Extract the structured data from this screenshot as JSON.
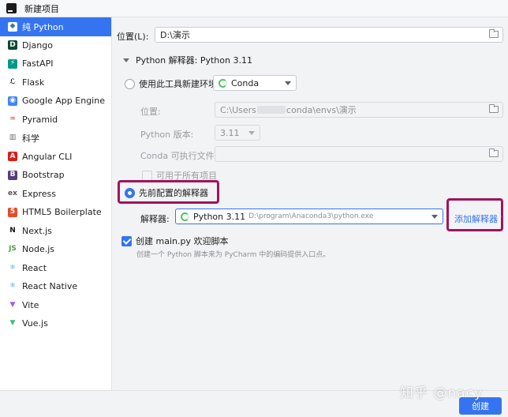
{
  "window": {
    "title": "新建项目"
  },
  "sidebar": {
    "items": [
      {
        "label": "纯 Python",
        "icon": "python-icon",
        "glyph": "◆",
        "bg": "#ffffff",
        "fg": "#3776ab"
      },
      {
        "label": "Django",
        "icon": "django-icon",
        "glyph": "D",
        "bg": "#0c4b33",
        "fg": "#ffffff"
      },
      {
        "label": "FastAPI",
        "icon": "fastapi-icon",
        "glyph": "⚡",
        "bg": "#05998b",
        "fg": "#ffffff"
      },
      {
        "label": "Flask",
        "icon": "flask-icon",
        "glyph": "ℒ",
        "bg": "#ffffff",
        "fg": "#222222"
      },
      {
        "label": "Google App Engine",
        "icon": "google-app-engine-icon",
        "glyph": "◉",
        "bg": "#4285f4",
        "fg": "#ffffff"
      },
      {
        "label": "Pyramid",
        "icon": "pyramid-icon",
        "glyph": "♒",
        "bg": "#ffffff",
        "fg": "#c0392b"
      },
      {
        "label": "科学",
        "icon": "scientific-icon",
        "glyph": "▥",
        "bg": "#ffffff",
        "fg": "#6b6d72"
      },
      {
        "label": "Angular CLI",
        "icon": "angular-icon",
        "glyph": "A",
        "bg": "#dd1b16",
        "fg": "#ffffff"
      },
      {
        "label": "Bootstrap",
        "icon": "bootstrap-icon",
        "glyph": "B",
        "bg": "#563d7c",
        "fg": "#ffffff"
      },
      {
        "label": "Express",
        "icon": "express-icon",
        "glyph": "ex",
        "bg": "#ffffff",
        "fg": "#555555"
      },
      {
        "label": "HTML5 Boilerplate",
        "icon": "html5-icon",
        "glyph": "5",
        "bg": "#e44d26",
        "fg": "#ffffff"
      },
      {
        "label": "Next.js",
        "icon": "nextjs-icon",
        "glyph": "N",
        "bg": "#ffffff",
        "fg": "#111111"
      },
      {
        "label": "Node.js",
        "icon": "nodejs-icon",
        "glyph": "JS",
        "bg": "#ffffff",
        "fg": "#539e43"
      },
      {
        "label": "React",
        "icon": "react-icon",
        "glyph": "⚛",
        "bg": "#ffffff",
        "fg": "#1e9bd7"
      },
      {
        "label": "React Native",
        "icon": "react-native-icon",
        "glyph": "⚛",
        "bg": "#ffffff",
        "fg": "#1e9bd7"
      },
      {
        "label": "Vite",
        "icon": "vite-icon",
        "glyph": "▼",
        "bg": "#ffffff",
        "fg": "#9c5cf6"
      },
      {
        "label": "Vue.js",
        "icon": "vue-icon",
        "glyph": "▼",
        "bg": "#ffffff",
        "fg": "#41b883"
      }
    ]
  },
  "location": {
    "label": "位置(L):",
    "value": "D:\\演示"
  },
  "interpreter_section": {
    "title": "Python 解释器: Python 3.11"
  },
  "new_env": {
    "radio_label": "使用此工具新建环境",
    "tool": "Conda",
    "location_label": "位置:",
    "location_prefix": "C:\\Users",
    "location_suffix": "conda\\envs\\演示",
    "python_version_label": "Python 版本:",
    "python_version": "3.11",
    "conda_exe_label": "Conda 可执行文件:",
    "all_projects_label": "可用于所有项目"
  },
  "existing": {
    "radio_label": "先前配置的解释器",
    "interpreter_label": "解释器:",
    "interpreter_name": "Python 3.11",
    "interpreter_path": "D:\\program\\Anaconda3\\python.exe",
    "add_interpreter": "添加解释器"
  },
  "welcome": {
    "checkbox_label": "创建 main.py 欢迎脚本",
    "description": "创建一个 Python 脚本来为 PyCharm 中的编码提供入口点。"
  },
  "footer": {
    "create": "创建"
  },
  "watermark": "知乎 @nacy",
  "colors": {
    "accent": "#3574f0",
    "highlight": "#a2135c"
  }
}
